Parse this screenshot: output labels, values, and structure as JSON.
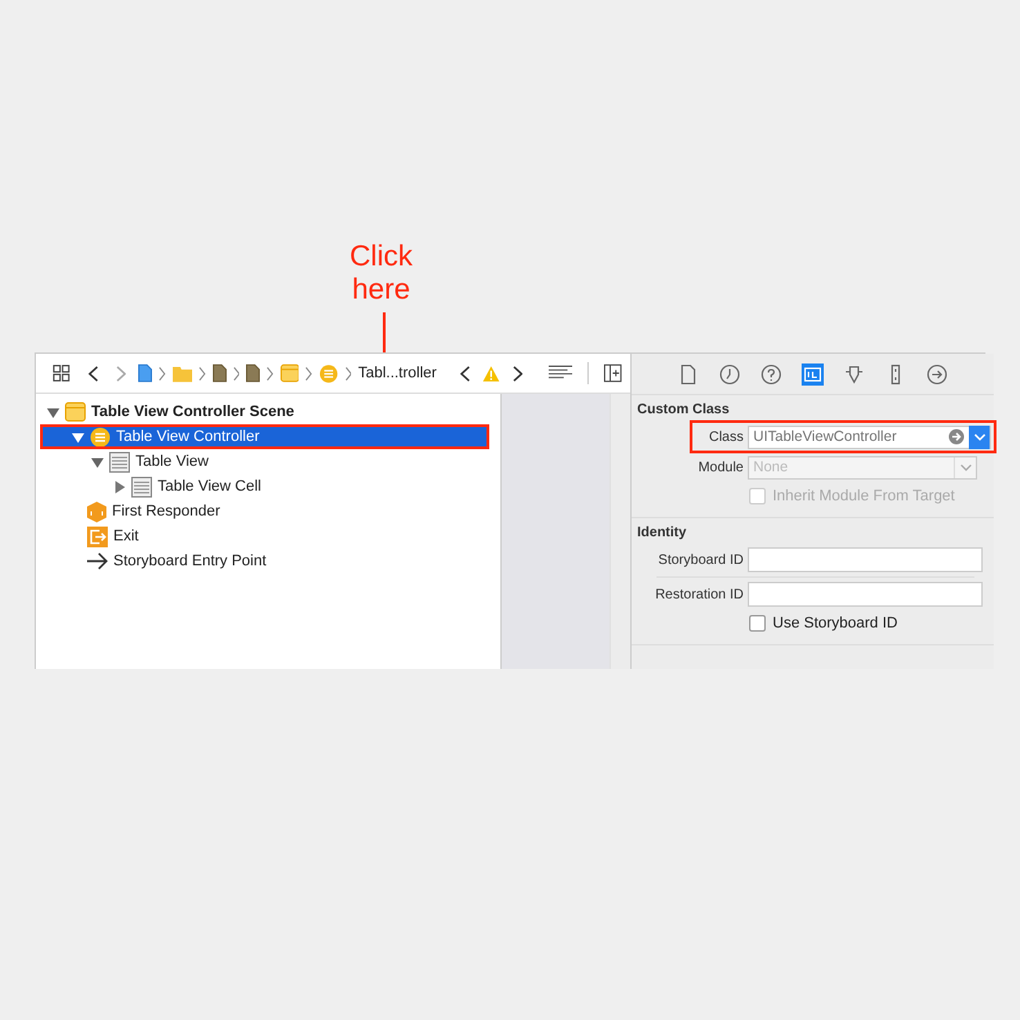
{
  "annotation": {
    "text": "Click here"
  },
  "toolbar": {
    "crumbs": [
      {
        "kind": "file"
      },
      {
        "kind": "folder"
      },
      {
        "kind": "doc"
      },
      {
        "kind": "doc"
      },
      {
        "kind": "scene"
      },
      {
        "kind": "controller"
      }
    ],
    "crumb_label": "Tabl...troller"
  },
  "tree": [
    {
      "label": "Table View Controller Scene",
      "kind": "scene",
      "expanded": true,
      "selected": false,
      "children": [
        {
          "label": "Table View Controller",
          "kind": "controller",
          "expanded": true,
          "selected": true,
          "children": [
            {
              "label": "Table View",
              "kind": "table",
              "expanded": true,
              "selected": false,
              "children": [
                {
                  "label": "Table View Cell",
                  "kind": "table",
                  "expanded": false,
                  "selected": false
                }
              ]
            }
          ]
        },
        {
          "label": "First Responder",
          "kind": "responder",
          "selected": false
        },
        {
          "label": "Exit",
          "kind": "exit",
          "selected": false
        },
        {
          "label": "Storyboard Entry Point",
          "kind": "entry",
          "selected": false
        }
      ]
    }
  ],
  "inspector_tabs": [
    {
      "kind": "file",
      "selected": false
    },
    {
      "kind": "history",
      "selected": false
    },
    {
      "kind": "help",
      "selected": false
    },
    {
      "kind": "identity",
      "selected": true
    },
    {
      "kind": "attributes",
      "selected": false
    },
    {
      "kind": "size",
      "selected": false
    },
    {
      "kind": "connections",
      "selected": false
    }
  ],
  "custom_class": {
    "title": "Custom Class",
    "class_label": "Class",
    "class_placeholder": "UITableViewController",
    "class_highlighted": true,
    "module_label": "Module",
    "module_placeholder": "None",
    "module_disabled": true,
    "inherit_label": "Inherit Module From Target",
    "inherit_checked": false,
    "inherit_disabled": true
  },
  "identity": {
    "title": "Identity",
    "storyboard_label": "Storyboard ID",
    "restoration_label": "Restoration ID",
    "use_label": "Use Storyboard ID",
    "use_checked": false
  }
}
